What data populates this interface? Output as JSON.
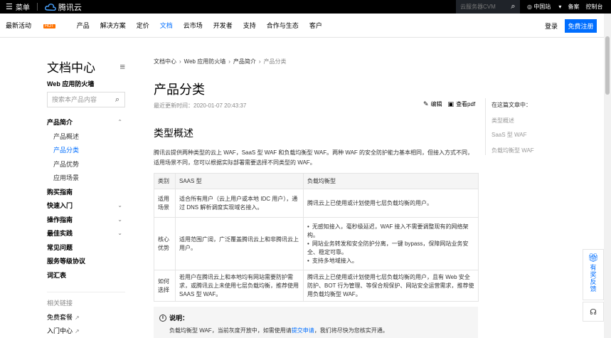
{
  "topbar": {
    "menu_label": "菜单",
    "brand": "腾讯云",
    "search_placeholder": "云服务器CVM",
    "site": "中国站",
    "filing": "备案",
    "console": "控制台"
  },
  "navbar": {
    "items": [
      "最新活动",
      "产品",
      "解决方案",
      "定价",
      "文档",
      "云市场",
      "开发者",
      "支持",
      "合作与生态",
      "客户"
    ],
    "hot_badge": "HOT",
    "login": "登录",
    "register": "免费注册"
  },
  "sidebar": {
    "title": "文档中心",
    "product": "Web 应用防火墙",
    "search_placeholder": "搜索本产品内容",
    "items": [
      {
        "label": "产品简介"
      },
      {
        "label": "产品概述"
      },
      {
        "label": "产品分类"
      },
      {
        "label": "产品优势"
      },
      {
        "label": "应用场景"
      },
      {
        "label": "购买指南"
      },
      {
        "label": "快速入门"
      },
      {
        "label": "操作指南"
      },
      {
        "label": "最佳实践"
      },
      {
        "label": "常见问题"
      },
      {
        "label": "服务等级协议"
      },
      {
        "label": "词汇表"
      }
    ],
    "related_title": "相关链接",
    "links": [
      "免费套餐",
      "入门中心"
    ]
  },
  "main": {
    "breadcrumb": [
      "文档中心",
      "Web 应用防火墙",
      "产品简介",
      "产品分类"
    ],
    "title": "产品分类",
    "updated": "最近更新时间：2020-01-07 20:43:37",
    "edit": "编辑",
    "view_pdf": "查看pdf",
    "section_title": "类型概述",
    "intro": "腾讯云提供两种类型的云上 WAF，SaaS 型 WAF 和负载均衡型 WAF。两种 WAF 的安全防护能力基本相同，但接入方式不同，适用场景不同，您可以根据实际部署需要选择不同类型的 WAF。",
    "table": {
      "headers": [
        "类别",
        "SAAS 型",
        "负载均衡型"
      ],
      "rows": [
        {
          "label": "适用场景",
          "saas": "适合所有用户（云上用户或本地 IDC 用户），通过 DNS 解析调度实现域名接入。",
          "clb": "腾讯云上已使用或计划使用七层负载均衡的用户。"
        },
        {
          "label": "核心优势",
          "saas": "适用范围广阔，广泛覆盖腾讯云上和非腾讯云上用户。",
          "clb_list": [
            "无感知接入，毫秒级延迟，WAF 接入不需要调整现有的网络架构。",
            "网站业务转发和安全防护分离，一键 bypass，保障网站业务安全、稳定可靠。",
            "支持多地域接入。"
          ]
        },
        {
          "label": "如何选择",
          "saas": "若用户在腾讯云上和本地均有网站需要防护需求，或腾讯云上未使用七层负载均衡，推荐使用 SAAS 型 WAF。",
          "clb": "腾讯云上已使用或计划使用七层负载均衡的用户，且有 Web 安全防护、BOT 行为管理、等保合规保护、网站安全运营需求，推荐使用负载均衡型 WAF。"
        }
      ]
    },
    "note_title": "说明：",
    "note_prefix": "负载均衡型 WAF，当前灰度开放中，如需使用请",
    "note_link": "提交申请",
    "note_suffix": "，我们将尽快为您核实开通。"
  },
  "toc": {
    "heading": "在这篇文章中：",
    "items": [
      "类型概述",
      "SaaS 型 WAF",
      "负载均衡型 WAF"
    ]
  },
  "float": {
    "feedback": "有奖反馈"
  }
}
